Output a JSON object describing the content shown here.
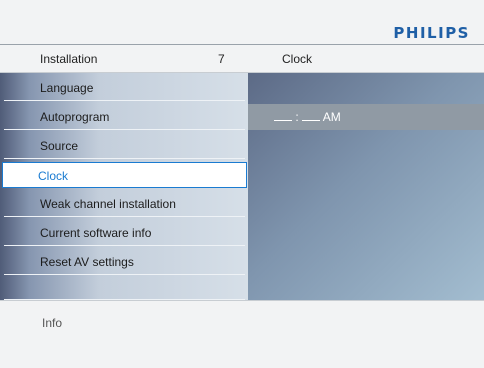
{
  "brand": "PHILIPS",
  "header": {
    "title": "Installation",
    "count": "7",
    "submenu_title": "Clock"
  },
  "menu": {
    "items": [
      {
        "label": "Language"
      },
      {
        "label": "Autoprogram"
      },
      {
        "label": "Source"
      },
      {
        "label": "Clock"
      },
      {
        "label": "Weak channel installation"
      },
      {
        "label": "Current software info"
      },
      {
        "label": "Reset AV settings"
      }
    ],
    "selected_index": 3
  },
  "clock": {
    "separator": ":",
    "period": "AM"
  },
  "footer": {
    "info_label": "Info"
  }
}
